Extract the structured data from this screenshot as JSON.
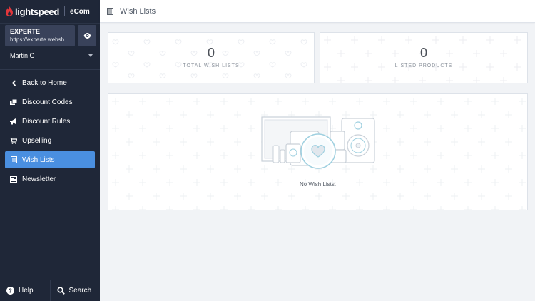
{
  "brand": {
    "name": "lightspeed",
    "product": "eCom"
  },
  "store": {
    "name": "EXPERTE",
    "url": "https://experte.websh..."
  },
  "user": {
    "name": "Martin G"
  },
  "nav": [
    {
      "label": "Back to Home",
      "icon": "chevron-left-icon"
    },
    {
      "label": "Discount Codes",
      "icon": "tickets-icon"
    },
    {
      "label": "Discount Rules",
      "icon": "megaphone-icon"
    },
    {
      "label": "Upselling",
      "icon": "cart-icon"
    },
    {
      "label": "Wish Lists",
      "icon": "list-icon",
      "active": true
    },
    {
      "label": "Newsletter",
      "icon": "newspaper-icon"
    }
  ],
  "footer": {
    "help": "Help",
    "search": "Search"
  },
  "page": {
    "title": "Wish Lists"
  },
  "stats": [
    {
      "value": "0",
      "label": "TOTAL WISH LISTS"
    },
    {
      "value": "0",
      "label": "LISTED PRODUCTS"
    }
  ],
  "empty_state": {
    "message": "No Wish Lists."
  },
  "colors": {
    "sidebar": "#1f2738",
    "accent": "#4a8fe0",
    "brand_red": "#e2363b"
  }
}
